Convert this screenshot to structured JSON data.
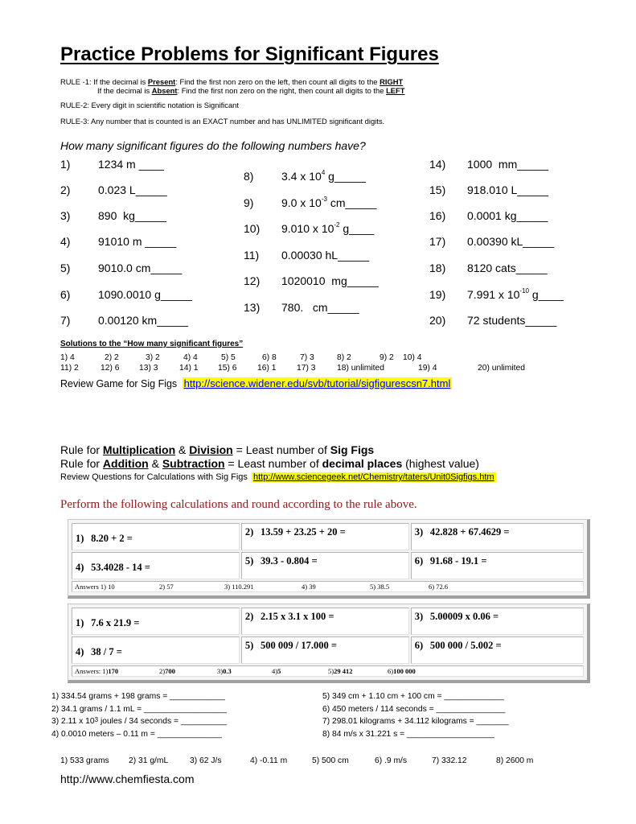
{
  "title": "Practice Problems for Significant Figures",
  "rules": {
    "rule1_prefix": "RULE -1: If the decimal is ",
    "rule1_present": "Present",
    "rule1_mid": ": Find the first non zero on the left, then count all digits to the ",
    "rule1_right": "RIGHT",
    "rule1b_prefix": "If the decimal is ",
    "rule1b_absent": "Absent",
    "rule1b_mid": ": Find the first non zero on the right, then count all digits to the ",
    "rule1b_left": "LEFT",
    "rule2": "RULE-2: Every digit in scientific notation is Significant",
    "rule3": "RULE-3: Any number that is counted is an EXACT number and has UNLIMITED significant digits."
  },
  "question_heading": "How many significant figures do the following numbers have?",
  "sigfig_items": [
    {
      "num": "1)",
      "text": "1234 m ____"
    },
    {
      "num": "2)",
      "text": "0.023 L_____"
    },
    {
      "num": "3)",
      "text": "890  kg_____"
    },
    {
      "num": "4)",
      "text": "91010 m _____"
    },
    {
      "num": "5)",
      "text": "9010.0 cm_____"
    },
    {
      "num": "6)",
      "text": "1090.0010 g_____"
    },
    {
      "num": "7)",
      "text": "0.00120 km_____"
    },
    {
      "num": "8)",
      "base": "3.4 x 10",
      "exp": "4",
      "tail": " g_____"
    },
    {
      "num": "9)",
      "base": "9.0 x 10",
      "exp": "-3",
      "tail": " cm_____"
    },
    {
      "num": "10)",
      "base": "9.010 x 10",
      "exp": "-2",
      "tail": " g____"
    },
    {
      "num": "11)",
      "text": "0.00030 hL_____"
    },
    {
      "num": "12)",
      "text": "1020010  mg_____"
    },
    {
      "num": "13)",
      "text": "780.   cm_____"
    },
    {
      "num": "14)",
      "text": "1000  mm_____"
    },
    {
      "num": "15)",
      "text": "918.010 L_____"
    },
    {
      "num": "16)",
      "text": "0.0001 kg_____"
    },
    {
      "num": "17)",
      "text": "0.00390 kL_____"
    },
    {
      "num": "18)",
      "text": "8120 cats_____"
    },
    {
      "num": "19)",
      "base": "7.991 x 10",
      "exp": "-10",
      "tail": " g____"
    },
    {
      "num": "20)",
      "text": "72 students_____"
    }
  ],
  "solutions": {
    "heading": "Solutions to the “How many significant figures”",
    "row1": [
      "1) 4",
      "2) 2",
      "3) 2",
      "4) 4",
      "5) 5",
      "6) 8",
      "7) 3",
      "8) 2",
      "9) 2",
      "10) 4"
    ],
    "row2": [
      "11) 2",
      "12) 6",
      "13) 3",
      "14) 1",
      "15) 6",
      "16) 1",
      "17) 3",
      "18) unlimited",
      "19) 4",
      "20) unlimited"
    ]
  },
  "review_game": {
    "label": "Review Game for Sig Figs",
    "link": "http://science.widener.edu/svb/tutorial/sigfigurescsn7.html"
  },
  "calc_rules": {
    "mult_prefix": "Rule for ",
    "mult": "Multiplication",
    "amp": " & ",
    "div": "Division",
    "mult_suffix": " = Least number of ",
    "mult_bold": "Sig Figs",
    "add_prefix": "Rule for ",
    "add": "Addition",
    "sub": "Subtraction",
    "add_suffix": " = Least number of ",
    "add_bold": "decimal places",
    "add_tail": " (highest value)"
  },
  "review_questions": {
    "label": "Review Questions for Calculations with Sig Figs",
    "link": "http://www.sciencegeek.net/Chemistry/taters/Unit0Sigfigs.htm"
  },
  "perform_heading": "Perform the following calculations and round according to the rule above.",
  "table1": {
    "cells": [
      {
        "n": "1)",
        "expr": "8.20 + 2 ="
      },
      {
        "n": "2)",
        "expr": "13.59 + 23.25 + 20 ="
      },
      {
        "n": "3)",
        "expr": "42.828 + 67.4629 ="
      },
      {
        "n": "4)",
        "expr": "53.4028 - 14 ="
      },
      {
        "n": "5)",
        "expr": "39.3 - 0.804 ="
      },
      {
        "n": "6)",
        "expr": "91.68 - 19.1 ="
      }
    ],
    "answers": [
      "Answers 1) 10",
      "2) 57",
      "3) 110.291",
      "4) 39",
      "5) 38.5",
      "6) 72.6"
    ]
  },
  "table2": {
    "cells": [
      {
        "n": "1)",
        "expr": "7.6 x 21.9 ="
      },
      {
        "n": "2)",
        "expr": "2.15 x 3.1 x 100 ="
      },
      {
        "n": "3)",
        "expr": "5.00009 x 0.06 ="
      },
      {
        "n": "4)",
        "expr": "38 / 7 ="
      },
      {
        "n": "5)",
        "expr": "500 009 / 17.000 ="
      },
      {
        "n": "6)",
        "expr": "500 000 / 5.002 ="
      }
    ],
    "answers_label": "Answers: 1)",
    "answers": [
      {
        "pre": "",
        "val": "170"
      },
      {
        "pre": "2)",
        "val": "700"
      },
      {
        "pre": "3)",
        "val": "0.3"
      },
      {
        "pre": "4)",
        "val": "5"
      },
      {
        "pre": "5)",
        "val": "29 412"
      },
      {
        "pre": "6)",
        "val": "100 000"
      }
    ]
  },
  "unit_calcs": [
    {
      "text": "1)  334.54 grams + 198 grams = ____________"
    },
    {
      "text": "2)  34.1 grams / 1.1 mL = __________________"
    },
    {
      "pre": "3)  2.11 x 10",
      "exp": "3",
      "post": " joules / 34 seconds = __________"
    },
    {
      "text": "4)  0.0010 meters – 0.11 m = ______________"
    },
    {
      "text": "5)  349 cm + 1.10 cm + 100 cm = _____________"
    },
    {
      "text": "6)  450 meters / 114 seconds = _______________"
    },
    {
      "text": "7)  298.01 kilograms + 34.112 kilograms = _______"
    },
    {
      "text": "8)  84 m/s x 31.221 s = ___________________"
    }
  ],
  "unit_answers": [
    "1)  533 grams",
    "2)  31 g/mL",
    "3)  62 J/s",
    "4)  -0.11 m",
    "5)  500 cm",
    "6)  .9 m/s",
    "7)  332.12",
    "8)  2600 m"
  ],
  "footer_url": "http://www.chemfiesta.com",
  "colors": {
    "highlight": "#ffff00",
    "link": "#0000ee",
    "perform_text": "#8b1a1a"
  }
}
